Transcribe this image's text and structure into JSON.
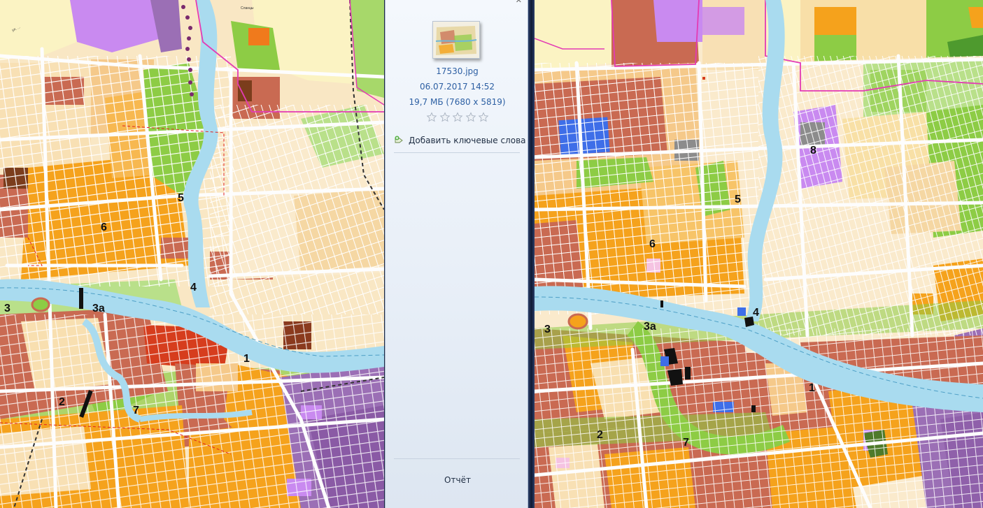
{
  "panel": {
    "file_name": "17530.jpg",
    "file_date": "06.07.2017    14:52",
    "file_size": "19,7 МБ (7680 x 5819)",
    "rating": 0,
    "add_keywords_label": "Добавить ключевые слова",
    "report_label": "Отчёт",
    "icons": [
      "add-tag-icon",
      "star-icon"
    ]
  },
  "map_left": {
    "labels": [
      "1",
      "2",
      "3",
      "3а",
      "4",
      "5",
      "6",
      "7"
    ],
    "small_labels": [
      "Сланцы",
      "ул. ..."
    ]
  },
  "map_right": {
    "labels": [
      "1",
      "2",
      "3",
      "3а",
      "4",
      "5",
      "6",
      "7",
      "8"
    ]
  },
  "colors": {
    "residential_low": "#fae6c2",
    "residential_mid": "#f7d39a",
    "residential_high": "#f5a21c",
    "commercial": "#c96a52",
    "green": "#8dcc45",
    "water": "#a9dbef",
    "industrial": "#9b6fb5",
    "special": "#3e6ee8",
    "road": "#ffffff",
    "boundary": "#e33bb4",
    "historic_center": "#d63d1d"
  }
}
